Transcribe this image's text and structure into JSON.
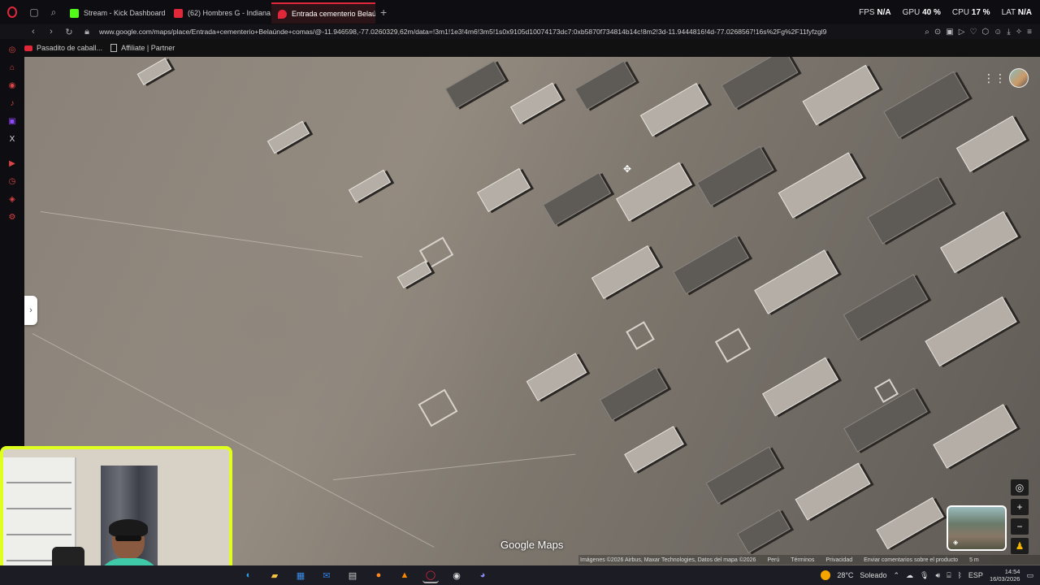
{
  "tabs": [
    {
      "label": "Stream - Kick Dashboard",
      "color": "#53fc18"
    },
    {
      "label": "(62) Hombres G - Indiana",
      "color": "#e0283a"
    },
    {
      "label": "Entrada cementerio Belaúnde",
      "color": "#e0283a",
      "active": true
    }
  ],
  "hud": {
    "fps_label": "FPS",
    "fps_value": "N/A",
    "gpu_label": "GPU",
    "gpu_value": "40 %",
    "cpu_label": "CPU",
    "cpu_value": "17 %",
    "lat_label": "LAT",
    "lat_value": "N/A"
  },
  "address": {
    "url": "www.google.com/maps/place/Entrada+cementerio+Belaúnde+comas/@-11.946598,-77.0260329,62m/data=!3m1!1e3!4m6!3m5!1s0x9105d10074173dc7:0xb5870f734814b14c!8m2!3d-11.9444816!4d-77.0268567!16s%2Fg%2F11fyfzgl9"
  },
  "bookmarks": [
    {
      "label": "Pasadito de caball...",
      "icon": "youtube-icon"
    },
    {
      "label": "Affiliate | Partner",
      "icon": "document-icon"
    }
  ],
  "map": {
    "brand": "Google Maps",
    "footer": {
      "imagery": "Imágenes ©2026 Airbus, Maxar Technologies, Datos del mapa ©2026",
      "country": "Perú",
      "terms": "Términos",
      "privacy": "Privacidad",
      "feedback": "Enviar comentarios sobre el producto",
      "scale": "5 m"
    }
  },
  "taskbar": {
    "weather_temp": "28°C",
    "weather_text": "Soleado",
    "language": "ESP",
    "time": "14:54",
    "date": "16/03/2026"
  }
}
